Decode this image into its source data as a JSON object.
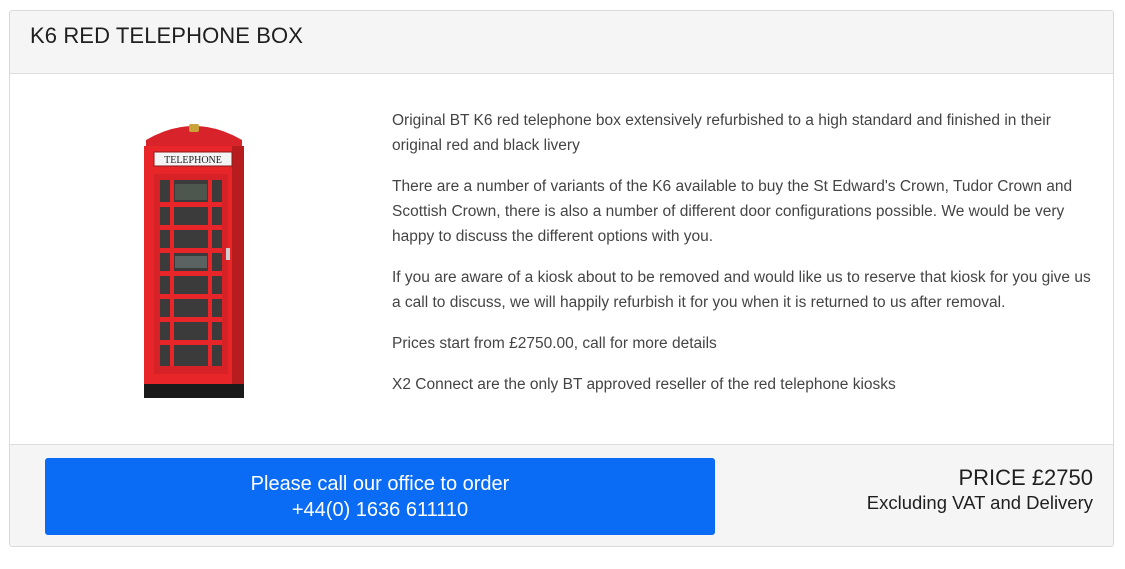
{
  "product": {
    "title": "K6 RED TELEPHONE BOX",
    "image_sign": "TELEPHONE",
    "description": [
      "Original BT K6 red telephone box extensively refurbished to a high standard and finished in their original red and black livery",
      "There are a number of variants of the K6 available to buy the St Edward's Crown, Tudor Crown and Scottish Crown, there is also a number of different door configurations possible. We would be very happy to discuss the different options with you.",
      "If you are aware of a kiosk about to be removed and would like us to reserve that kiosk for you give us a call to discuss, we will happily refurbish it for you when it is returned to us after removal.",
      "Prices start from £2750.00, call for more details",
      "X2 Connect are the only BT approved reseller of the red telephone kiosks"
    ]
  },
  "footer": {
    "order_button": {
      "line1": "Please call our office to order",
      "line2": "+44(0) 1636 611110"
    },
    "price_label": "PRICE £2750",
    "price_note": "Excluding VAT and Delivery"
  },
  "colors": {
    "button": "#0a6cf5",
    "kiosk_red": "#e8262a",
    "header_bg": "#f5f5f5"
  }
}
